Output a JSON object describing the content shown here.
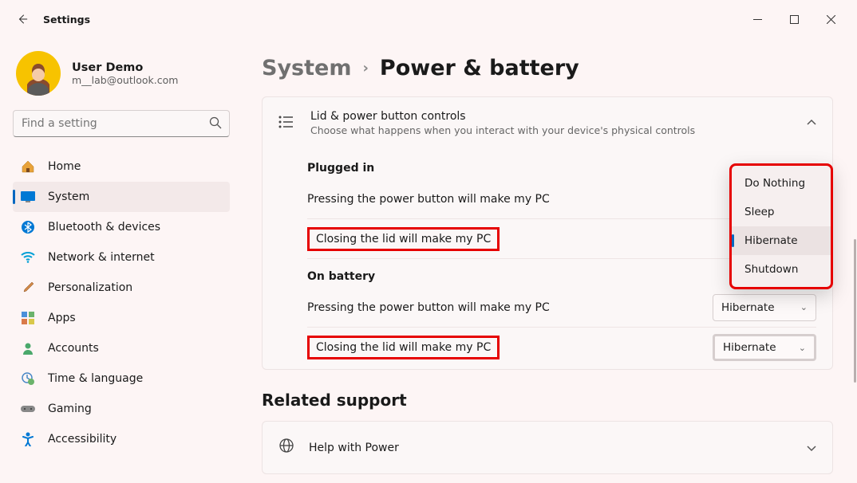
{
  "window": {
    "title": "Settings"
  },
  "user": {
    "name": "User Demo",
    "email": "m__lab@outlook.com"
  },
  "search": {
    "placeholder": "Find a setting"
  },
  "nav": [
    {
      "label": "Home",
      "icon": "🏠"
    },
    {
      "label": "System",
      "icon": "🖥️",
      "active": true
    },
    {
      "label": "Bluetooth & devices",
      "icon": "bt"
    },
    {
      "label": "Network & internet",
      "icon": "📶"
    },
    {
      "label": "Personalization",
      "icon": "🖌️"
    },
    {
      "label": "Apps",
      "icon": "app"
    },
    {
      "label": "Accounts",
      "icon": "👤"
    },
    {
      "label": "Time & language",
      "icon": "🌐"
    },
    {
      "label": "Gaming",
      "icon": "🎮"
    },
    {
      "label": "Accessibility",
      "icon": "acc"
    }
  ],
  "breadcrumb": {
    "parent": "System",
    "current": "Power & battery"
  },
  "card": {
    "title": "Lid & power button controls",
    "subtitle": "Choose what happens when you interact with your device's physical controls"
  },
  "plugged": {
    "heading": "Plugged in",
    "power_label": "Pressing the power button will make my PC",
    "lid_label": "Closing the lid will make my PC"
  },
  "battery": {
    "heading": "On battery",
    "power_label": "Pressing the power button will make my PC",
    "power_value": "Hibernate",
    "lid_label": "Closing the lid will make my PC",
    "lid_value": "Hibernate"
  },
  "dropdown_options": [
    "Do Nothing",
    "Sleep",
    "Hibernate",
    "Shutdown"
  ],
  "dropdown_selected": "Hibernate",
  "related": {
    "heading": "Related support",
    "help": "Help with Power"
  }
}
